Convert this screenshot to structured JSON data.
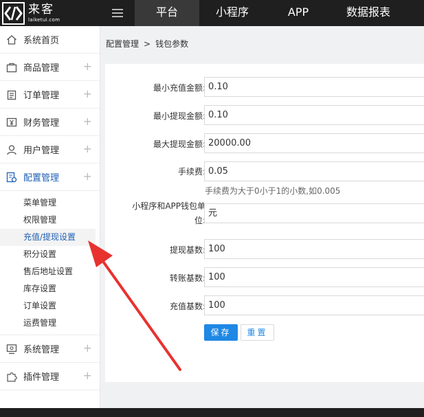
{
  "brand": {
    "name": "来客",
    "domain": "laiketui.com"
  },
  "nav": {
    "tabs": [
      "平台",
      "小程序",
      "APP",
      "数据报表"
    ],
    "active_index": 0
  },
  "sidebar": {
    "items": [
      {
        "label": "系统首页",
        "icon": "home-icon"
      },
      {
        "label": "商品管理",
        "icon": "shopping-bag-icon"
      },
      {
        "label": "订单管理",
        "icon": "clipboard-icon"
      },
      {
        "label": "财务管理",
        "icon": "yen-icon"
      },
      {
        "label": "用户管理",
        "icon": "user-icon"
      },
      {
        "label": "配置管理",
        "icon": "settings-doc-icon"
      },
      {
        "label": "系统管理",
        "icon": "monitor-icon"
      },
      {
        "label": "插件管理",
        "icon": "puzzle-icon"
      }
    ],
    "expand_symbol": "+",
    "submenu": [
      "菜单管理",
      "权限管理",
      "充值/提现设置",
      "积分设置",
      "售后地址设置",
      "库存设置",
      "订单设置",
      "运费管理"
    ],
    "active_sub_index": 2
  },
  "breadcrumb": {
    "parent": "配置管理",
    "separator": ">",
    "current": "钱包参数"
  },
  "form": {
    "min_recharge": {
      "label": "最小充值金额:",
      "value": "0.10"
    },
    "min_withdraw": {
      "label": "最小提现金额:",
      "value": "0.10"
    },
    "max_withdraw": {
      "label": "最大提现金额:",
      "value": "20000.00"
    },
    "fee": {
      "label": "手续费:",
      "value": "0.05",
      "hint": "手续费为大于0小于1的小数,如0.005"
    },
    "wallet_unit": {
      "label_line1": "小程序和APP钱包单",
      "label_line2": "位:",
      "value": "元"
    },
    "withdraw_base": {
      "label": "提现基数:",
      "value": "100"
    },
    "transfer_base": {
      "label": "转账基数:",
      "value": "100"
    },
    "recharge_base": {
      "label": "充值基数:",
      "value": "100"
    },
    "save_label": "保存",
    "reset_label": "重置"
  },
  "colors": {
    "topbar": "#1f1f1f",
    "accent": "#1e88e5",
    "active_text": "#1e5fb4",
    "annotation_arrow": "#e8322f"
  }
}
